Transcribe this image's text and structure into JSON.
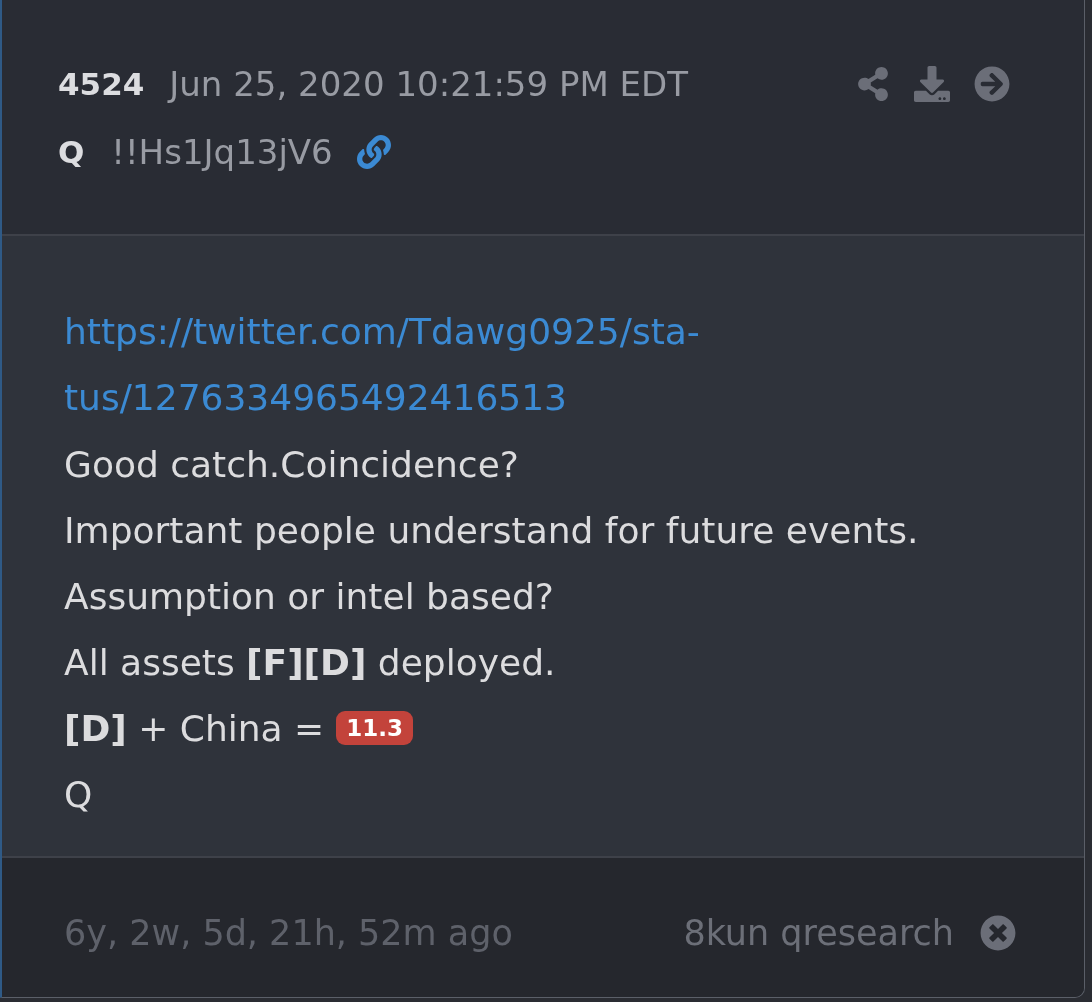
{
  "header": {
    "post_number": "4524",
    "timestamp": "Jun 25, 2020 10:21:59 PM EDT",
    "author": "Q",
    "tripcode": "!!Hs1Jq13jV6"
  },
  "body": {
    "link_lines": [
      "https://twitter.com/Tdawg0925/sta-",
      "tus/1276334965492416513"
    ],
    "lines": [
      {
        "text": "Good catch.Coincidence?"
      },
      {
        "text": "Important people understand for future events."
      },
      {
        "text": "Assumption or intel based?"
      },
      {
        "text": "All assets **[F][D]** deployed."
      },
      {
        "text": "**[D]** + China =",
        "badge": "11.3"
      },
      {
        "text": "Q"
      }
    ]
  },
  "footer": {
    "age": "6y, 2w, 5d, 21h, 52m ago",
    "source": "8kun qresearch"
  }
}
